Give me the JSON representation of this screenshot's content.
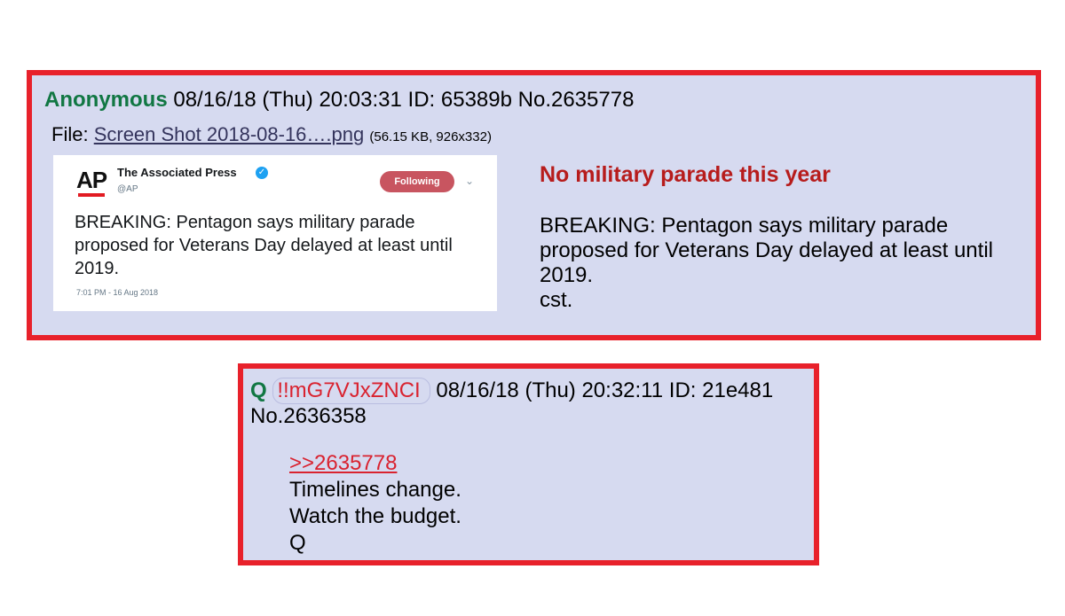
{
  "post1": {
    "name": "Anonymous",
    "date": "08/16/18 (Thu) 20:03:31",
    "id_label": "ID: 65389b",
    "post_no": "No.2635778",
    "file_label": "File:",
    "file_name": "Screen Shot 2018-08-16….png",
    "file_meta": "(56.15 KB, 926x332)",
    "tweet": {
      "logo_text": "AP",
      "account_name": "The Associated Press",
      "verified_glyph": "✓",
      "handle": "@AP",
      "follow_label": "Following",
      "chevron": "⌄",
      "body": "BREAKING: Pentagon says military parade proposed for Veterans Day delayed at least until 2019.",
      "timestamp": "7:01 PM - 16 Aug 2018"
    },
    "subject": "No military parade this year",
    "message_lines": [
      "BREAKING: Pentagon says military parade",
      "proposed for Veterans Day delayed at least until",
      "2019.",
      "cst."
    ]
  },
  "post2": {
    "name": "Q",
    "tripcode": "!!mG7VJxZNCI",
    "date": "08/16/18 (Thu) 20:32:11",
    "id_label": "ID: 21e481",
    "post_no": "No.2636358",
    "quote_link": ">>2635778",
    "message_lines": [
      "Timelines change.",
      "Watch the budget.",
      "Q"
    ]
  },
  "colors": {
    "post_bg": "#d6daf0",
    "border": "#e8212b",
    "name_green": "#117743",
    "subject_red": "#b71c1c",
    "link_red": "#d9222f"
  }
}
